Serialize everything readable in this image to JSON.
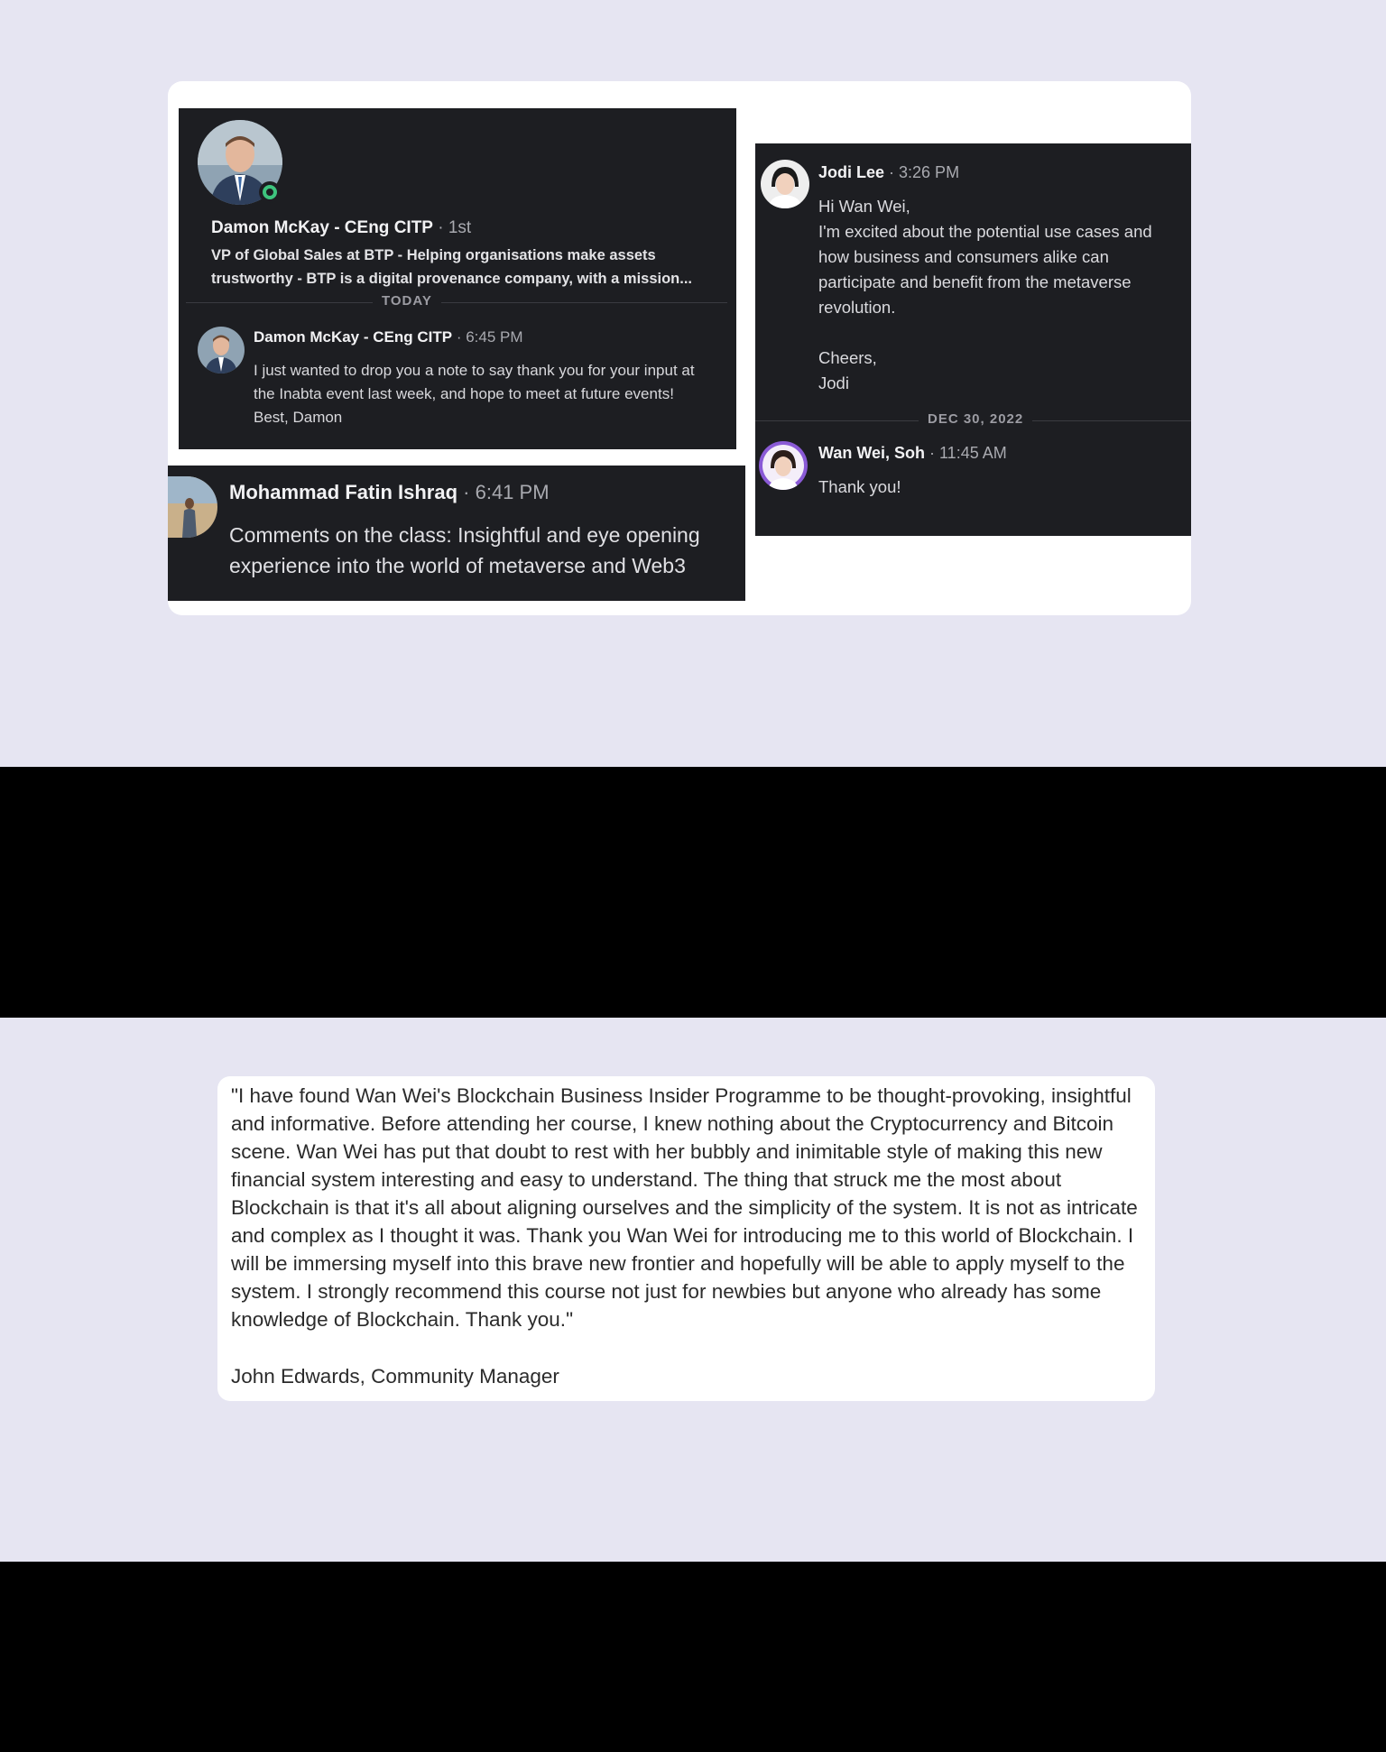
{
  "damon_card": {
    "name": "Damon McKay - CEng CITP",
    "connection": " · 1st",
    "headline": "VP of Global Sales at BTP - Helping organisations make assets trustworthy - BTP is a digital provenance company, with a mission...",
    "divider": "TODAY",
    "message_name": "Damon McKay - CEng CITP",
    "message_time": " · 6:45 PM",
    "message": "I just wanted to drop you a note to say thank you for your input at the Inabta event last week, and hope to meet at future events! Best, Damon"
  },
  "mohammad_card": {
    "name": "Mohammad Fatin Ishraq",
    "time": " · 6:41 PM",
    "message": "Comments on the class: Insightful and eye opening experience into the world of metaverse and Web3"
  },
  "jodi_card": {
    "name": "Jodi Lee",
    "time": " · 3:26 PM",
    "message": "Hi Wan Wei,\nI'm excited about the potential use cases and how business and consumers alike can participate and benefit from the metaverse revolution.\n\nCheers,\nJodi",
    "divider": "DEC 30, 2022",
    "reply_name": "Wan Wei, Soh",
    "reply_time": " · 11:45 AM",
    "reply": "Thank you!"
  },
  "testimonial": {
    "quote": "\"I have found Wan Wei's Blockchain Business Insider Programme to be thought-provoking, insightful and informative. Before attending her course, I knew nothing about the Cryptocurrency and Bitcoin scene. Wan Wei has put that doubt to rest with her bubbly and inimitable style of making this new financial system interesting and easy to understand. The thing that struck me the most about Blockchain is that it's all about aligning ourselves and the simplicity of the system. It is not as intricate and complex as I thought it was. Thank you Wan Wei for introducing me to this world of Blockchain. I will be immersing myself into this brave new frontier and hopefully will be able to apply myself to the system. I strongly recommend this course not just for newbies but anyone who already has some knowledge of Blockchain. Thank you.\"",
    "author": "John Edwards, Community Manager"
  },
  "colors": {
    "page_background": "#e6e5f2",
    "card_background": "#ffffff",
    "chat_background": "#1d1e22",
    "online_indicator": "#3ec47e",
    "band": "#000000"
  },
  "icons": {
    "online_status": "online-status-icon"
  }
}
